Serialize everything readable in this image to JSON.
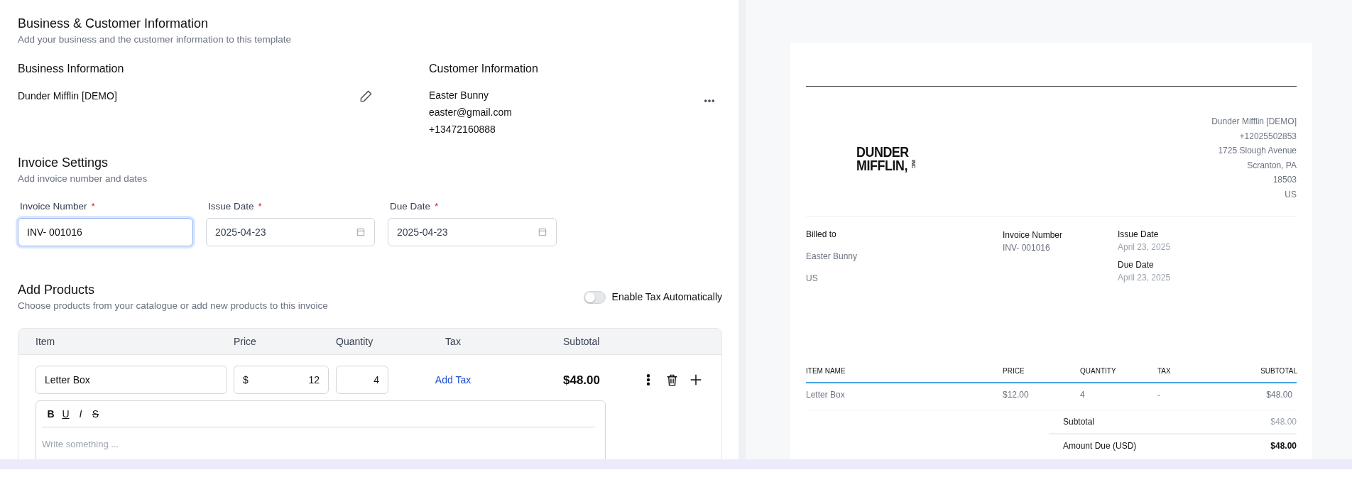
{
  "form": {
    "business_customer": {
      "title": "Business & Customer Information",
      "subtitle": "Add your business and the customer information to this template",
      "business": {
        "heading": "Business Information",
        "name": "Dunder Mifflin [DEMO]"
      },
      "customer": {
        "heading": "Customer Information",
        "name": "Easter Bunny",
        "email": "easter@gmail.com",
        "phone": "+13472160888"
      }
    },
    "invoice_settings": {
      "title": "Invoice Settings",
      "subtitle": "Add invoice number and dates",
      "fields": [
        {
          "label": "Invoice Number",
          "marker": "*",
          "value": "INV- 001016",
          "kind": "text",
          "focused": true
        },
        {
          "label": "Issue Date",
          "marker": "*",
          "value": "2025-04-23",
          "kind": "date",
          "focused": false
        },
        {
          "label": "Due Date",
          "marker": "*",
          "value": "2025-04-23",
          "kind": "date",
          "focused": false
        }
      ]
    },
    "products": {
      "title": "Add Products",
      "subtitle": "Choose products from your catalogue or add new products to this invoice",
      "toggle": {
        "label": "Enable Tax Automatically",
        "on": false
      },
      "columns": [
        "Item",
        "Price",
        "Quantity",
        "Tax",
        "Subtotal"
      ],
      "rows": [
        {
          "item": "Letter Box",
          "currency": "$",
          "price": "12",
          "quantity": "4",
          "tax_link": "Add Tax",
          "subtotal": "$48.00",
          "editor": {
            "toolbar": [
              {
                "label": "B",
                "kind": "bold"
              },
              {
                "label": "U",
                "kind": "underline"
              },
              {
                "label": "I",
                "kind": "italic"
              },
              {
                "label": "S",
                "kind": "strike"
              }
            ],
            "placeholder": "Write something ..."
          }
        }
      ]
    }
  },
  "preview": {
    "logo": {
      "lines": [
        "DUNDER",
        "MIFFLIN,"
      ],
      "suffix": "INC"
    },
    "address": [
      "Dunder Mifflin [DEMO]",
      "+12025502853",
      "1725 Slough Avenue",
      "Scranton, PA",
      "18503",
      "US"
    ],
    "billed_to": {
      "label": "Billed to",
      "lines": [
        "Easter Bunny",
        "US"
      ]
    },
    "invoice_number": {
      "label": "Invoice Number",
      "value": "INV- 001016"
    },
    "dates": [
      {
        "label": "Issue Date",
        "value": "April 23, 2025"
      },
      {
        "label": "Due Date",
        "value": "April 23, 2025"
      }
    ],
    "columns": [
      "ITEM NAME",
      "PRICE",
      "QUANTITY",
      "TAX",
      "SUBTOTAL"
    ],
    "rows": [
      [
        "Letter Box",
        "$12.00",
        "4",
        "-",
        "$48.00"
      ]
    ],
    "totals": [
      {
        "label": "Subtotal",
        "value": "$48.00",
        "kind": "subtotal"
      },
      {
        "label": "Amount Due (USD)",
        "value": "$48.00",
        "kind": "due"
      }
    ]
  }
}
